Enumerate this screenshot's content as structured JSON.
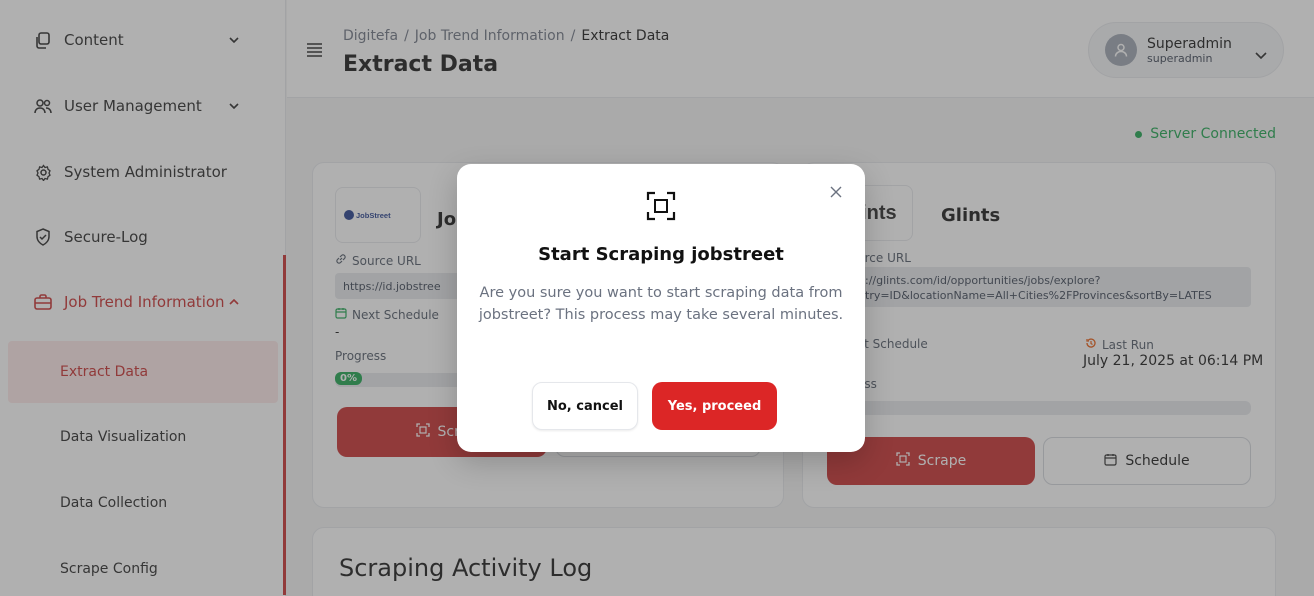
{
  "sidebar": {
    "items": [
      {
        "label": "Content",
        "icon": "copy-icon"
      },
      {
        "label": "User Management",
        "icon": "users-icon"
      },
      {
        "label": "System Administrator",
        "icon": "gear-icon"
      },
      {
        "label": "Secure-Log",
        "icon": "shield-check-icon"
      },
      {
        "label": "Job Trend Information",
        "icon": "briefcase-icon"
      }
    ],
    "subitems": [
      {
        "label": "Extract Data",
        "active": true
      },
      {
        "label": "Data Visualization"
      },
      {
        "label": "Data Collection"
      },
      {
        "label": "Scrape Config"
      }
    ]
  },
  "header": {
    "breadcrumb": [
      "Digitefa",
      "Job Trend Information",
      "Extract Data"
    ],
    "title": "Extract Data",
    "user": {
      "name": "Superadmin",
      "username": "superadmin"
    }
  },
  "status": {
    "server": "Server Connected",
    "color": "#16a34a"
  },
  "cards": [
    {
      "logo_text": "JobStreet",
      "title": "Jo",
      "source_label": "Source URL",
      "source_url": "https://id.jobstree",
      "schedule_label": "Next Schedule",
      "schedule_value": "-",
      "progress_label": "Progress",
      "progress": "0%",
      "scrape_label": "Scra"
    },
    {
      "logo_text": "glints",
      "title": "Glints",
      "source_label": "urce URL",
      "source_url": "://glints.com/id/opportunities/jobs/explore?\ntry=ID&locationName=All+Cities%2FProvinces&sortBy=LATES",
      "schedule_label": "xt Schedule",
      "last_run_label": "Last Run",
      "last_run_value": "July 21, 2025 at 06:14 PM",
      "progress_label": "ess",
      "scrape_label": "Scrape",
      "schedule_btn": "Schedule"
    }
  ],
  "log": {
    "title": "Scraping Activity Log"
  },
  "modal": {
    "title": "Start Scraping jobstreet",
    "message": "Are you sure you want to start scraping data from jobstreet? This process may take several minutes.",
    "cancel": "No, cancel",
    "confirm": "Yes, proceed"
  },
  "colors": {
    "accent": "#c62828",
    "danger": "#dc2626",
    "success": "#16a34a"
  }
}
